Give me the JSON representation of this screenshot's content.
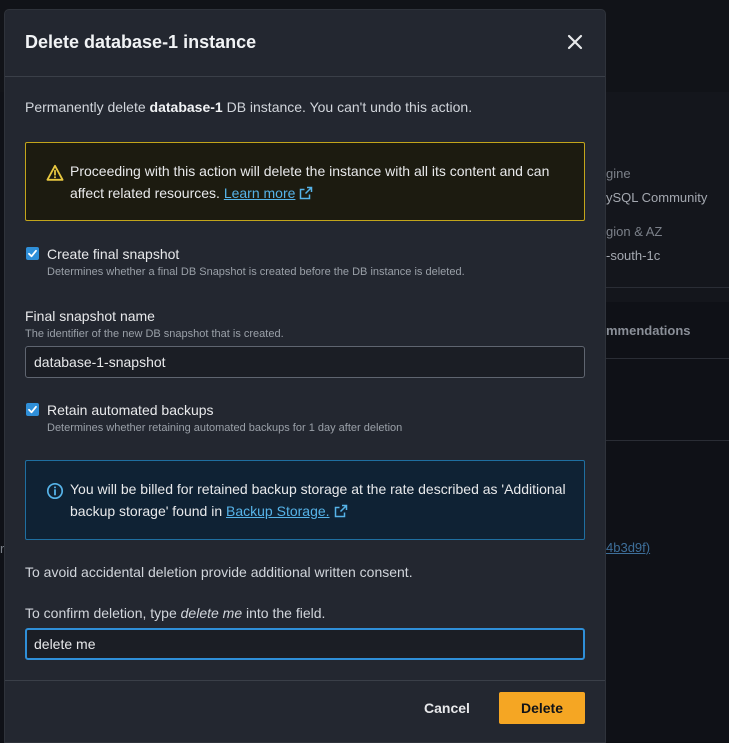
{
  "background": {
    "engine_label": "gine",
    "engine_value": "ySQL Community",
    "region_label": "gion & AZ",
    "region_value": "-south-1c",
    "tab_label": "mmendations",
    "partial_left": "r",
    "partial_id": "4b3d9f)"
  },
  "modal": {
    "title": "Delete database-1 instance",
    "intro_prefix": "Permanently delete ",
    "intro_db": "database-1",
    "intro_suffix": " DB instance. You can't undo this action.",
    "warning": {
      "text": "Proceeding with this action will delete the instance with all its content and can affect related resources.",
      "link": "Learn more"
    },
    "final_snapshot_checkbox": {
      "label": "Create final snapshot",
      "description": "Determines whether a final DB Snapshot is created before the DB instance is deleted.",
      "checked": true
    },
    "snapshot_name": {
      "label": "Final snapshot name",
      "description": "The identifier of the new DB snapshot that is created.",
      "value": "database-1-snapshot"
    },
    "retain_backups_checkbox": {
      "label": "Retain automated backups",
      "description": "Determines whether retaining automated backups for 1 day after deletion",
      "checked": true
    },
    "info": {
      "text": "You will be billed for retained backup storage at the rate described as 'Additional backup storage' found in",
      "link": "Backup Storage."
    },
    "consent_text": "To avoid accidental deletion provide additional written consent.",
    "confirm": {
      "prefix": "To confirm deletion, type ",
      "phrase": "delete me",
      "suffix": " into the field.",
      "value": "delete me"
    },
    "cancel_label": "Cancel",
    "delete_label": "Delete"
  },
  "colors": {
    "primary_button": "#f5a623",
    "warning_border": "#c2a51b",
    "info_border": "#1f6fa0",
    "link": "#56b3e8",
    "checkbox": "#2f8fd8"
  },
  "icons": [
    "close-icon",
    "warning-icon",
    "external-link-icon",
    "info-icon",
    "checkmark-icon"
  ]
}
